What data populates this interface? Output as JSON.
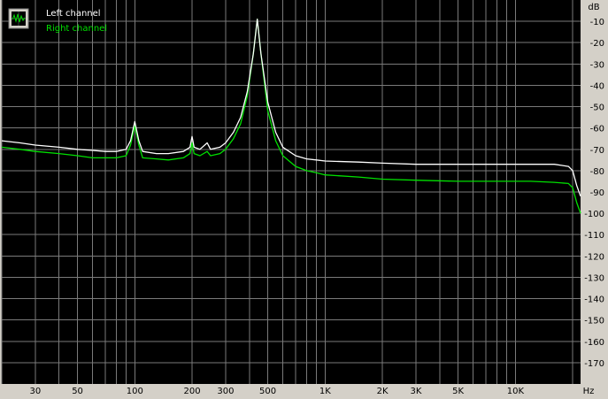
{
  "chart_data": {
    "type": "line",
    "title": "",
    "xlabel": "",
    "ylabel": "",
    "x_scale": "log",
    "xlim": [
      20,
      22000
    ],
    "ylim": [
      -180,
      0
    ],
    "grid": true,
    "legend_position": "top-left",
    "x_unit": "Hz",
    "y_unit": "dB",
    "x_ticks": [
      {
        "value": 30,
        "label": "30"
      },
      {
        "value": 50,
        "label": "50"
      },
      {
        "value": 100,
        "label": "100"
      },
      {
        "value": 200,
        "label": "200"
      },
      {
        "value": 300,
        "label": "300"
      },
      {
        "value": 500,
        "label": "500"
      },
      {
        "value": 1000,
        "label": "1K"
      },
      {
        "value": 2000,
        "label": "2K"
      },
      {
        "value": 3000,
        "label": "3K"
      },
      {
        "value": 5000,
        "label": "5K"
      },
      {
        "value": 10000,
        "label": "10K"
      }
    ],
    "y_ticks": [
      -10,
      -20,
      -30,
      -40,
      -50,
      -60,
      -70,
      -80,
      -90,
      -100,
      -110,
      -120,
      -130,
      -140,
      -150,
      -160,
      -170
    ],
    "series": [
      {
        "name": "Left channel",
        "color": "#ffffff",
        "points": [
          [
            20,
            -66
          ],
          [
            25,
            -67
          ],
          [
            30,
            -68
          ],
          [
            40,
            -69
          ],
          [
            50,
            -70
          ],
          [
            60,
            -70.5
          ],
          [
            70,
            -71
          ],
          [
            80,
            -71
          ],
          [
            90,
            -70
          ],
          [
            95,
            -66
          ],
          [
            100,
            -57
          ],
          [
            105,
            -66
          ],
          [
            110,
            -71
          ],
          [
            130,
            -72
          ],
          [
            150,
            -72
          ],
          [
            180,
            -71
          ],
          [
            195,
            -69
          ],
          [
            200,
            -64
          ],
          [
            205,
            -69
          ],
          [
            220,
            -70
          ],
          [
            240,
            -67
          ],
          [
            250,
            -70
          ],
          [
            280,
            -69
          ],
          [
            300,
            -67
          ],
          [
            330,
            -62
          ],
          [
            360,
            -55
          ],
          [
            390,
            -43
          ],
          [
            420,
            -25
          ],
          [
            440,
            -9
          ],
          [
            460,
            -25
          ],
          [
            500,
            -48
          ],
          [
            550,
            -62
          ],
          [
            600,
            -69
          ],
          [
            700,
            -73
          ],
          [
            800,
            -74.5
          ],
          [
            900,
            -75
          ],
          [
            1000,
            -75.5
          ],
          [
            1500,
            -76
          ],
          [
            2000,
            -76.5
          ],
          [
            3000,
            -77
          ],
          [
            5000,
            -77
          ],
          [
            8000,
            -77
          ],
          [
            12000,
            -77
          ],
          [
            16000,
            -77
          ],
          [
            19000,
            -78
          ],
          [
            20000,
            -80
          ],
          [
            21000,
            -87
          ],
          [
            22000,
            -92
          ]
        ]
      },
      {
        "name": "Right channel",
        "color": "#00e000",
        "points": [
          [
            20,
            -69
          ],
          [
            25,
            -70
          ],
          [
            30,
            -71
          ],
          [
            40,
            -72
          ],
          [
            50,
            -73
          ],
          [
            60,
            -74
          ],
          [
            70,
            -74
          ],
          [
            80,
            -74
          ],
          [
            90,
            -73
          ],
          [
            95,
            -68
          ],
          [
            100,
            -59
          ],
          [
            105,
            -68
          ],
          [
            110,
            -74
          ],
          [
            130,
            -74.5
          ],
          [
            150,
            -75
          ],
          [
            180,
            -74
          ],
          [
            195,
            -72
          ],
          [
            200,
            -67
          ],
          [
            205,
            -72
          ],
          [
            220,
            -73
          ],
          [
            240,
            -71
          ],
          [
            250,
            -73
          ],
          [
            280,
            -72
          ],
          [
            300,
            -70
          ],
          [
            330,
            -65
          ],
          [
            360,
            -58
          ],
          [
            390,
            -45
          ],
          [
            420,
            -25
          ],
          [
            440,
            -9
          ],
          [
            460,
            -25
          ],
          [
            500,
            -52
          ],
          [
            550,
            -66
          ],
          [
            600,
            -73
          ],
          [
            700,
            -78
          ],
          [
            800,
            -80
          ],
          [
            900,
            -81
          ],
          [
            1000,
            -82
          ],
          [
            1500,
            -83
          ],
          [
            2000,
            -84
          ],
          [
            3000,
            -84.5
          ],
          [
            5000,
            -85
          ],
          [
            8000,
            -85
          ],
          [
            12000,
            -85
          ],
          [
            16000,
            -85.5
          ],
          [
            19000,
            -86
          ],
          [
            20000,
            -88
          ],
          [
            21000,
            -95
          ],
          [
            22000,
            -100
          ]
        ]
      }
    ]
  },
  "legend": {
    "left_label": "Left channel",
    "right_label": "Right channel",
    "icon": "oscilloscope-icon"
  }
}
